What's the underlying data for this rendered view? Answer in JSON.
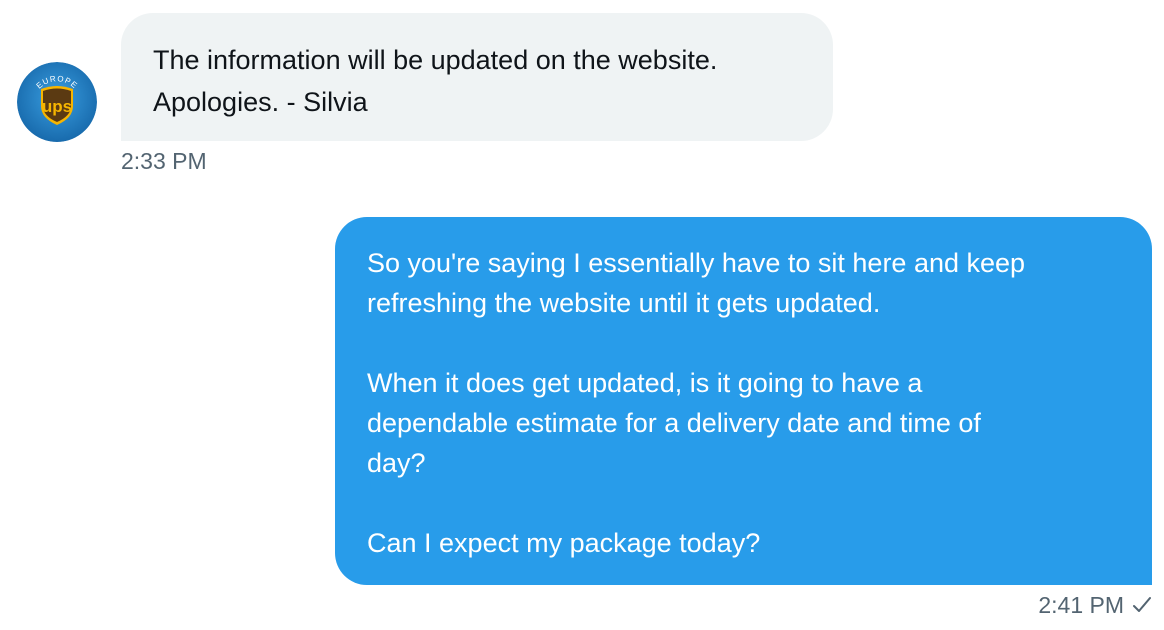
{
  "conversation": {
    "incoming": {
      "avatar_icon": "ups-europe-logo-icon",
      "avatar_logo_text": "ups",
      "avatar_region_text": "EUROPE",
      "lines": [
        "The information will be updated on the website.",
        "Apologies. - Silvia"
      ],
      "timestamp": "2:33 PM"
    },
    "outgoing": {
      "paragraphs": [
        {
          "lines": [
            "So you're saying I essentially have to sit here and keep",
            "refreshing the website until it gets updated."
          ]
        },
        {
          "lines": [
            "When it does get updated, is it going to have a",
            "dependable estimate for a delivery date and time of",
            "day?"
          ]
        },
        {
          "lines": [
            "Can I expect my package today?"
          ]
        }
      ],
      "timestamp": "2:41 PM",
      "status_icon": "checkmark-sent-icon"
    }
  },
  "colors": {
    "incoming_bubble": "#eff3f4",
    "outgoing_bubble": "#289cea",
    "timestamp_text": "#536471",
    "avatar_background": "#1f7fc0",
    "ups_shield_brown": "#5b3a12",
    "ups_gold": "#f7b500"
  }
}
